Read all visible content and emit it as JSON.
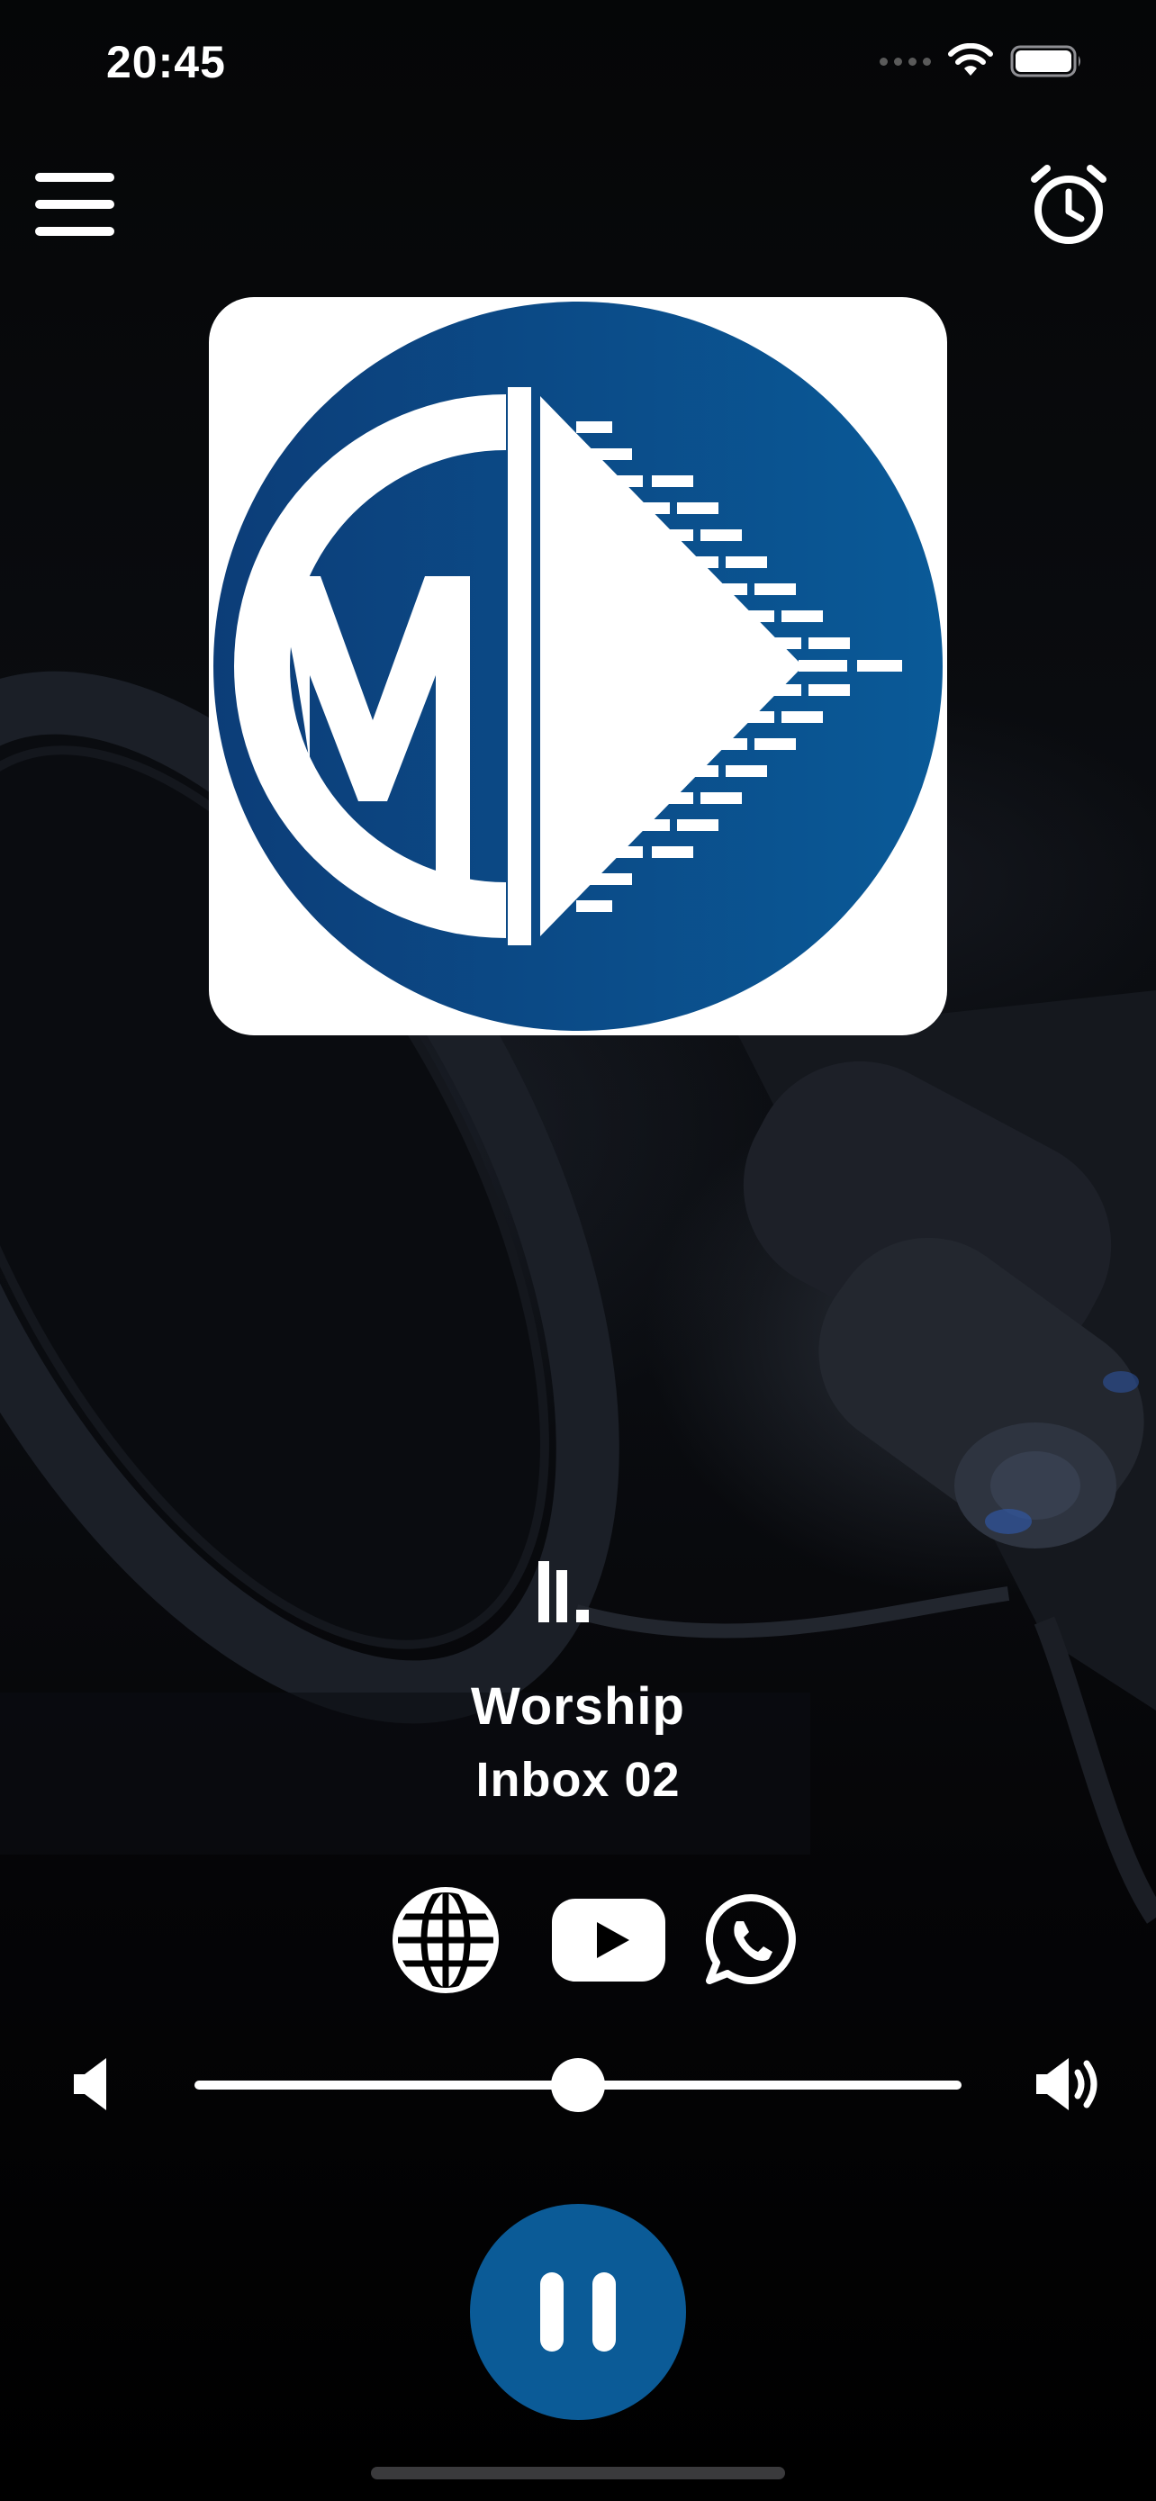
{
  "status_bar": {
    "time": "20:45",
    "icons": [
      "cellular-signal-icon",
      "wifi-icon",
      "battery-icon"
    ]
  },
  "header": {
    "menu_icon": "hamburger-menu-icon",
    "alarm_icon": "alarm-clock-icon"
  },
  "station": {
    "logo_icon": "station-logo-m-play",
    "now_playing_icon": "equalizer-icon",
    "title": "Worship",
    "subtitle": "Inbox 02"
  },
  "social": {
    "icons": [
      "globe-icon",
      "youtube-icon",
      "whatsapp-icon"
    ]
  },
  "volume": {
    "level": 0.5,
    "low_icon": "volume-low-icon",
    "high_icon": "volume-high-icon"
  },
  "player": {
    "state": "playing",
    "button_icon": "pause-icon"
  },
  "colors": {
    "accent": "#0b5b97",
    "logo_blue": "#0d4b8a",
    "background": "#000000",
    "text": "#ffffff"
  }
}
